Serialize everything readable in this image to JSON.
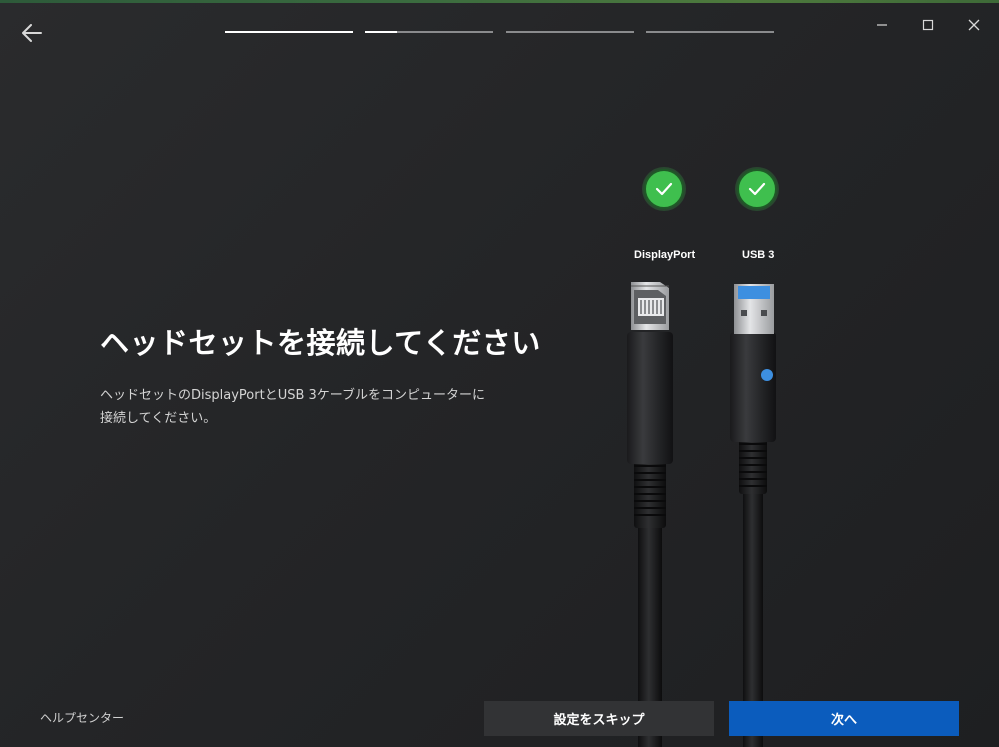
{
  "header": {
    "back_icon": "arrow-left-icon",
    "progress": {
      "total_steps": 4,
      "fills": [
        1.0,
        0.25,
        0.0,
        0.0
      ]
    },
    "window_controls": [
      "minimize-icon",
      "maximize-icon",
      "close-icon"
    ]
  },
  "main": {
    "title": "ヘッドセットを接続してください",
    "description": "ヘッドセットのDisplayPortとUSB 3ケーブルをコンピューターに接続してください。"
  },
  "connectors": [
    {
      "label": "DisplayPort",
      "status_icon": "check-icon",
      "status_color": "#3fbf4e"
    },
    {
      "label": "USB 3",
      "status_icon": "check-icon",
      "status_color": "#3fbf4e"
    }
  ],
  "footer": {
    "help_label": "ヘルプセンター",
    "skip_label": "設定をスキップ",
    "next_label": "次へ"
  },
  "colors": {
    "background": "#242527",
    "accent": "#0b5cbd",
    "success": "#3fbf4e",
    "usb_blue": "#3d8fe0"
  }
}
